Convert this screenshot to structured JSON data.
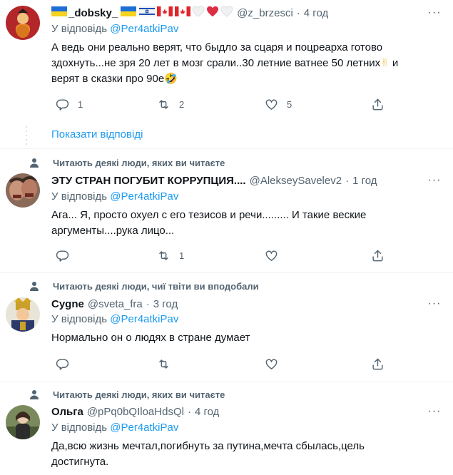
{
  "tweets": [
    {
      "name": "_dobsky_",
      "handle": "@z_brzesci",
      "time": "4 год",
      "reply_label": "У відповідь",
      "reply_to": "@Per4atkiPav",
      "text_line1": "А ведь они реально верят, что быдло за сцаря и поцреарха готово",
      "text_line2": "здохнуть...не зря 20 лет в мозг срали..30 летние ватнее 50 летних",
      "text_line2_emoji": "✌",
      "text_line2_end": " и",
      "text_line3": "верят в сказки про 90е",
      "text_line3_emoji": "🤣",
      "replies": "1",
      "retweets": "2",
      "likes": "5"
    },
    {
      "context": "Читають деякі люди, яких ви читаєте",
      "name": "ЭТУ СТРАН ПОГУБИТ КОРРУПЦИЯ....",
      "handle": "@AlekseySavelev2",
      "time": "1 год",
      "reply_label": "У відповідь",
      "reply_to": "@Per4atkiPav",
      "text_line1": "Ага... Я, просто охуел с его тезисов и речи......... И такие веские",
      "text_line2": "аргументы....рука лицо...",
      "replies": "",
      "retweets": "1",
      "likes": ""
    },
    {
      "context": "Читають деякі люди, чиї твіти ви вподобали",
      "name": "Cygne",
      "handle": "@sveta_fra",
      "time": "3 год",
      "reply_label": "У відповідь",
      "reply_to": "@Per4atkiPav",
      "text_line1": "Нормально он о людях в стране думает",
      "replies": "",
      "retweets": "",
      "likes": ""
    },
    {
      "context": "Читають деякі люди, яких ви читаєте",
      "name": "Ольга",
      "handle": "@pPq0bQIloaHdsQl",
      "time": "4 год",
      "reply_label": "У відповідь",
      "reply_to": "@Per4atkiPav",
      "text_line1": "Да,всю жизнь мечтал,погибнуть за путина,мечта сбылась,цель",
      "text_line2": "достигнута.",
      "replies": "",
      "retweets": "",
      "likes": ""
    }
  ],
  "show_replies": "Показати відповіді",
  "colors": {
    "accent": "#1d9bf0",
    "secondary_text": "#536471",
    "divider": "#eff3f4"
  },
  "icons": [
    "reply-icon",
    "retweet-icon",
    "like-icon",
    "share-icon",
    "more-icon",
    "person-icon"
  ]
}
